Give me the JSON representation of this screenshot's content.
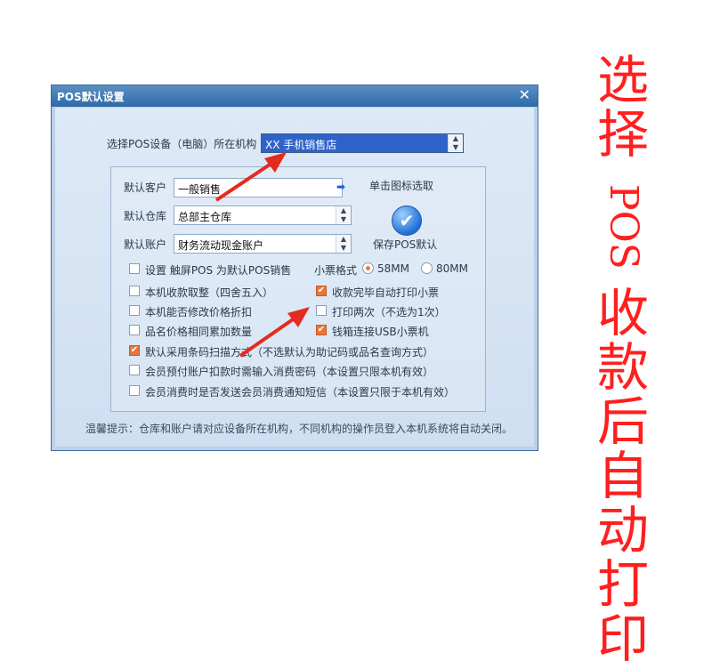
{
  "dialog": {
    "title": "POS默认设置",
    "close_glyph": "✕"
  },
  "device": {
    "label": "选择POS设备（电脑）所在机构",
    "value": "XX 手机销售店"
  },
  "defaults": {
    "customer_label": "默认客户",
    "customer_value": "一般销售",
    "warehouse_label": "默认仓库",
    "warehouse_value": "总部主仓库",
    "account_label": "默认账户",
    "account_value": "财务流动现金账户"
  },
  "save": {
    "hint": "单击图标选取",
    "label": "保存POS默认"
  },
  "options": [
    {
      "label": "设置 触屏POS 为默认POS销售",
      "checked": false
    },
    {
      "label": "本机收款取整（四舍五入）",
      "checked": false
    },
    {
      "label": "本机能否修改价格折扣",
      "checked": false
    },
    {
      "label": "品名价格相同累加数量",
      "checked": false
    },
    {
      "label": "默认采用条码扫描方式（不选默认为助记码或品名查询方式）",
      "checked": true
    },
    {
      "label": "会员预付账户扣款时需输入消费密码（本设置只限本机有效）",
      "checked": false
    },
    {
      "label": "会员消费时是否发送会员消费通知短信（本设置只限于本机有效）",
      "checked": false
    }
  ],
  "ticket": {
    "format_label": "小票格式",
    "opt58": "58MM",
    "opt80": "80MM",
    "selected": "58MM",
    "auto_print": "收款完毕自动打印小票",
    "print_twice": "打印两次（不选为1次）",
    "cashbox_usb": "钱箱连接USB小票机"
  },
  "footer": "温馨提示：仓库和账户请对应设备所在机构，不同机构的操作员登入本机系统将自动关闭。",
  "annotation": [
    "选",
    "择",
    "POS",
    "收",
    "款",
    "后",
    "自",
    "动",
    "打",
    "印"
  ],
  "colors": {
    "accent": "#e5773a",
    "annotation": "#ff1f1f",
    "selection": "#2f63c8"
  }
}
